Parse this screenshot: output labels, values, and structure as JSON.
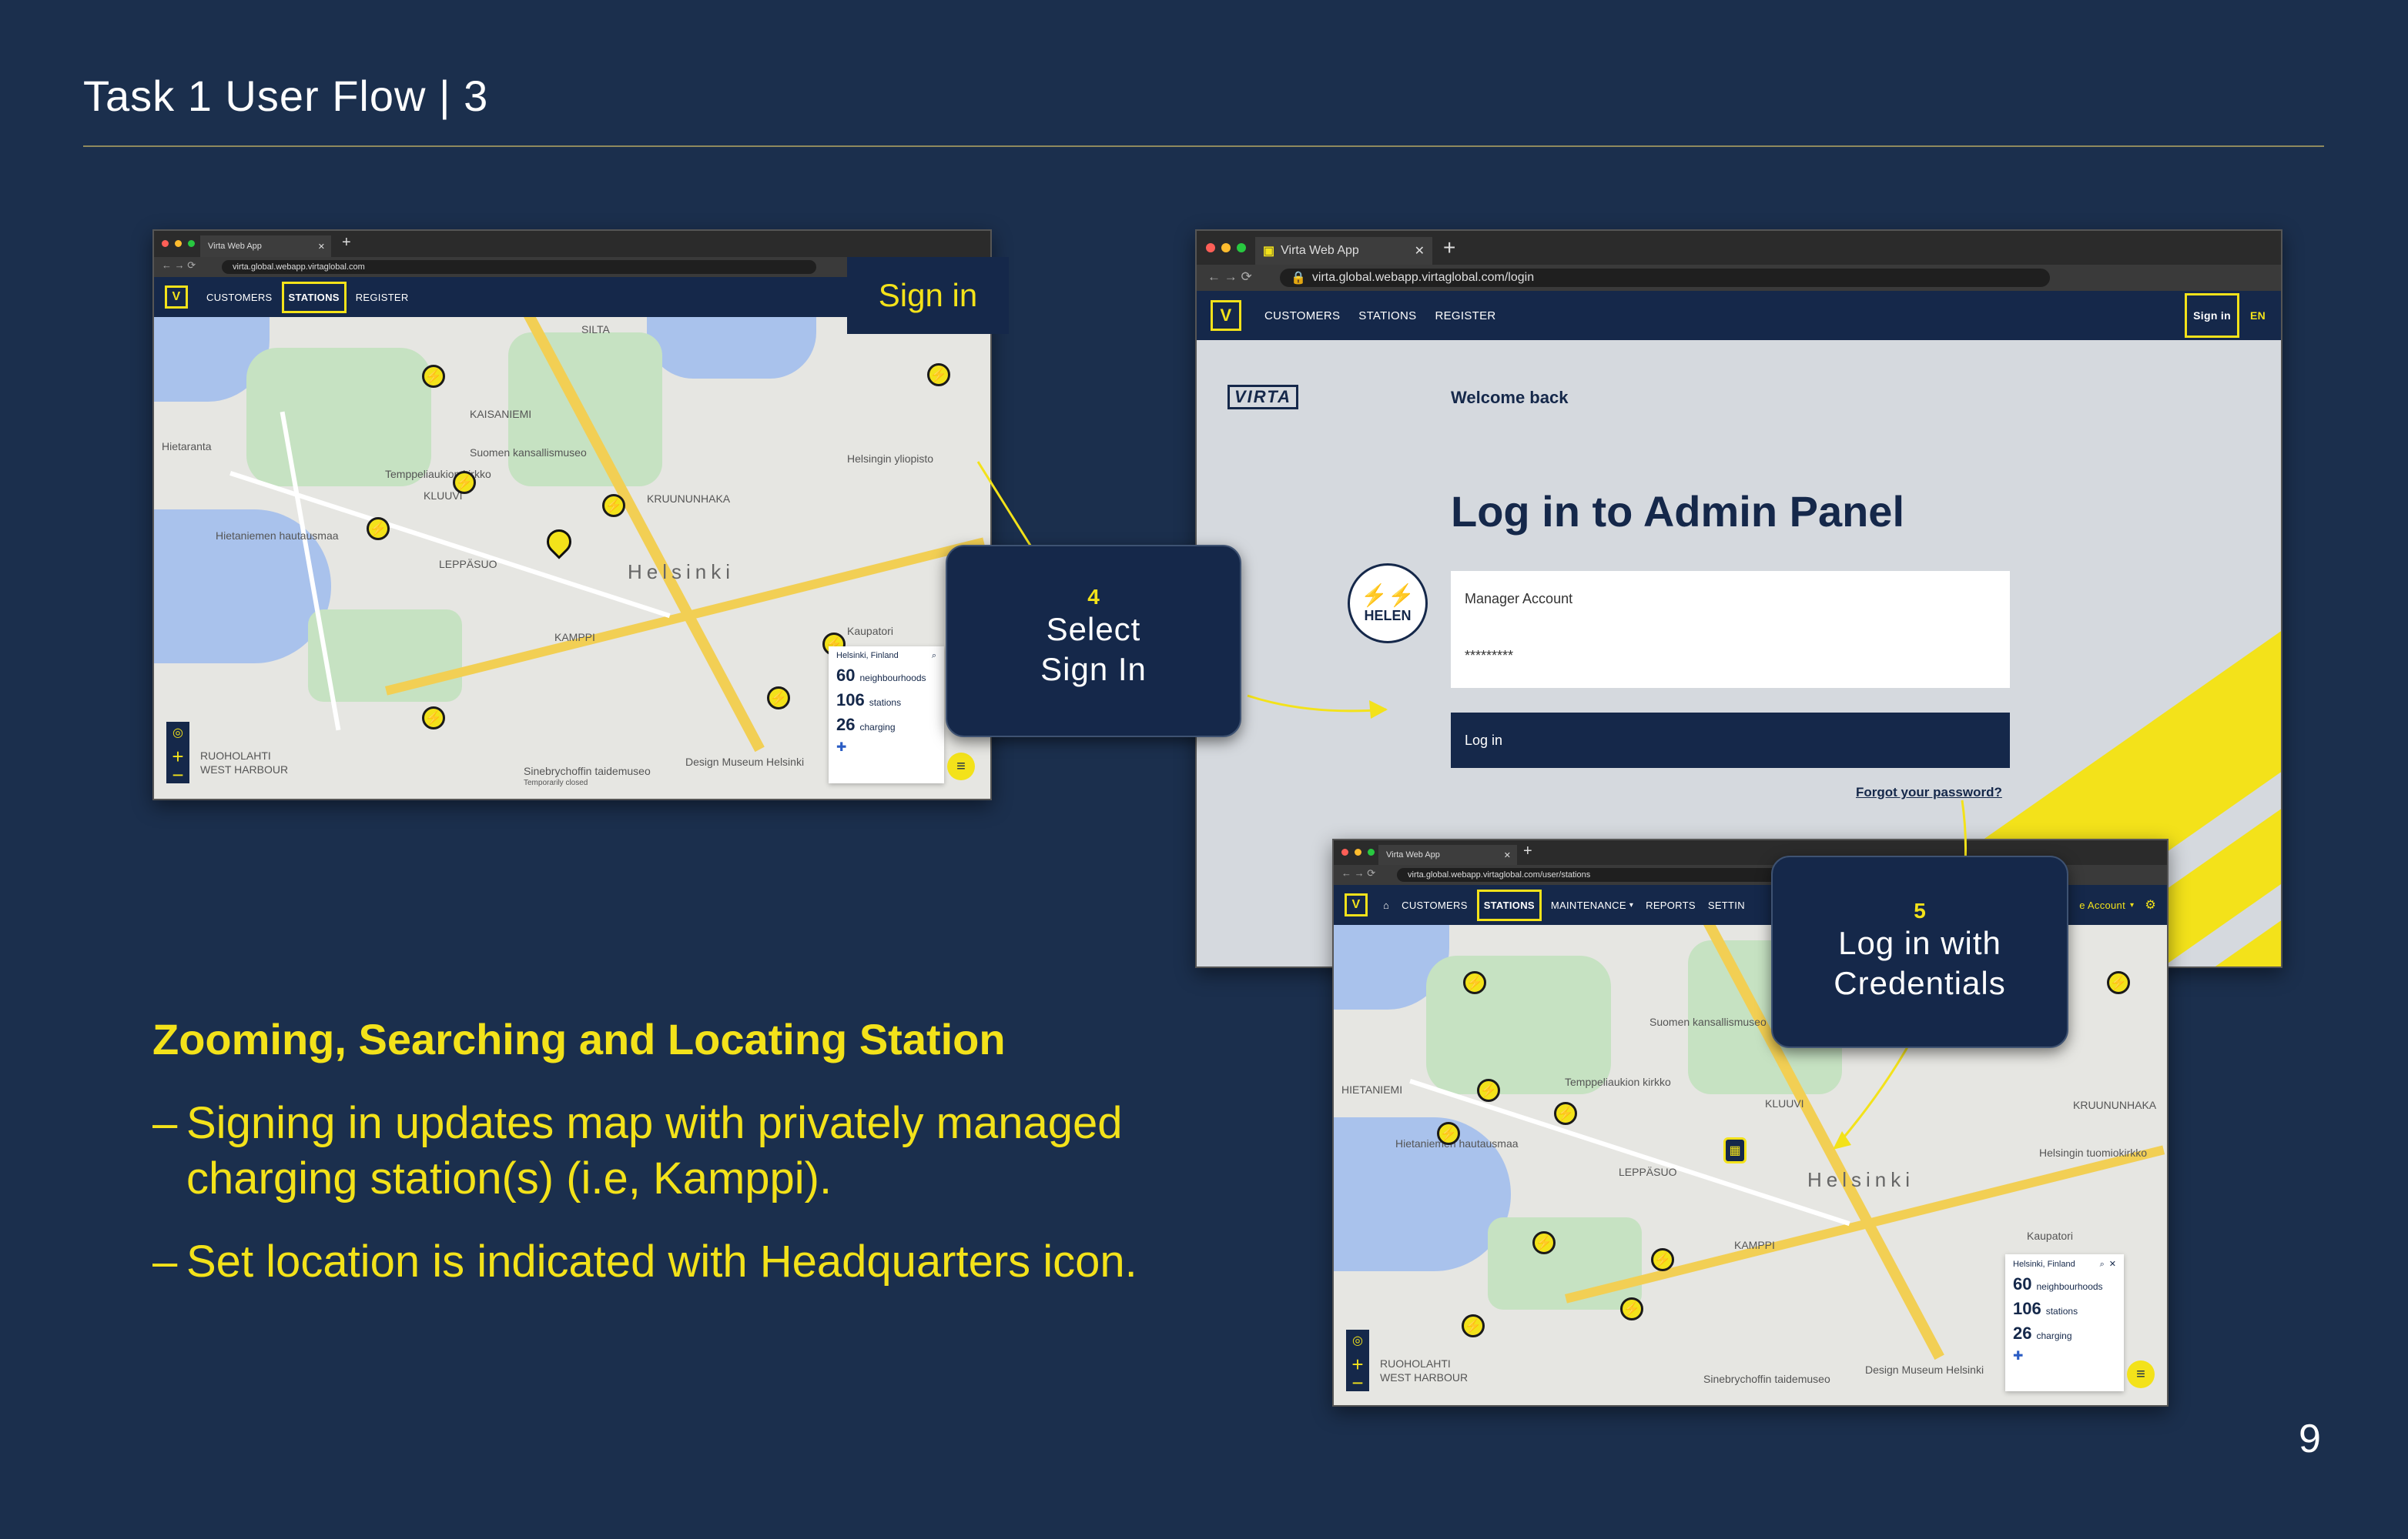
{
  "slide": {
    "title": "Task 1 User Flow  |  3",
    "page_number": "9"
  },
  "colors": {
    "background": "#1b2f4d",
    "accent": "#f3e21a",
    "navy": "#15284a"
  },
  "window1": {
    "tab_title": "Virta Web App",
    "url": "virta.global.webapp.virtaglobal.com",
    "nav": [
      "CUSTOMERS",
      "STATIONS",
      "REGISTER"
    ],
    "active_nav": "STATIONS",
    "map": {
      "city_label": "Helsinki",
      "district_labels": [
        "KAISANIEMI",
        "KLUUVI",
        "LEPPÄSUO",
        "KAMPPI",
        "RUOHOLAHTI",
        "WEST HARBOUR",
        "KRUUNUNHAKA",
        "SILTA"
      ],
      "poi_labels": [
        "Suomen kansallismuseo",
        "Temppeliaukion kirkko",
        "Hietaniemen hautausmaa",
        "Design Museum Helsinki",
        "Sinebrychoffin taidemuseo",
        "Temporarily closed",
        "Kaupatori",
        "Helsingin yliopisto",
        "Hietaranta"
      ]
    },
    "stats": {
      "location": "Helsinki, Finland",
      "neighbourhoods_count": "60",
      "neighbourhoods_label": "neighbourhoods",
      "stations_count": "106",
      "stations_label": "stations",
      "charging_count": "26",
      "charging_label": "charging"
    }
  },
  "signin_callout": "Sign in",
  "callout4": {
    "step": "4",
    "line1": "Select",
    "line2": "Sign In"
  },
  "window2": {
    "tab_title": "Virta Web App",
    "url": "virta.global.webapp.virtaglobal.com/login",
    "nav": [
      "CUSTOMERS",
      "STATIONS",
      "REGISTER"
    ],
    "signin_label": "Sign in",
    "lang_label": "EN",
    "brand_logo": "VIRTA",
    "welcome": "Welcome back",
    "heading": "Log in to Admin Panel",
    "partner_logo": "HELEN",
    "account_field": "Manager Account",
    "password_field": "*********",
    "login_button": "Log in",
    "forgot_link": "Forgot your password?"
  },
  "callout5": {
    "step": "5",
    "line1": "Log in with",
    "line2": "Credentials"
  },
  "window3": {
    "tab_title": "Virta Web App",
    "url": "virta.global.webapp.virtaglobal.com/user/stations",
    "nav": [
      "CUSTOMERS",
      "STATIONS",
      "MAINTENANCE",
      "REPORTS",
      "SETTIN"
    ],
    "active_nav": "STATIONS",
    "account_label": "e Account",
    "map": {
      "city_label": "Helsinki",
      "district_labels": [
        "HIETANIEMI",
        "KLUUVI",
        "LEPPÄSUO",
        "KAMPPI",
        "RUOHOLAHTI",
        "WEST HARBOUR",
        "KRUUNUNHAKA"
      ],
      "poi_labels": [
        "Suomen kansallismuseo",
        "Temppeliaukion kirkko",
        "Hietaniemen hautausmaa",
        "Design Museum Helsinki",
        "Sinebrychoffin taidemuseo",
        "Kaupatori",
        "Helsingin tuomiokirkko"
      ]
    },
    "stats": {
      "location": "Helsinki, Finland",
      "neighbourhoods_count": "60",
      "neighbourhoods_label": "neighbourhoods",
      "stations_count": "106",
      "stations_label": "stations",
      "charging_count": "26",
      "charging_label": "charging"
    }
  },
  "section": {
    "heading": "Zooming, Searching and Locating Station",
    "bullets": [
      "Signing in updates map with privately managed charging station(s) (i.e, Kamppi).",
      "Set location is indicated with Headquarters icon."
    ]
  }
}
